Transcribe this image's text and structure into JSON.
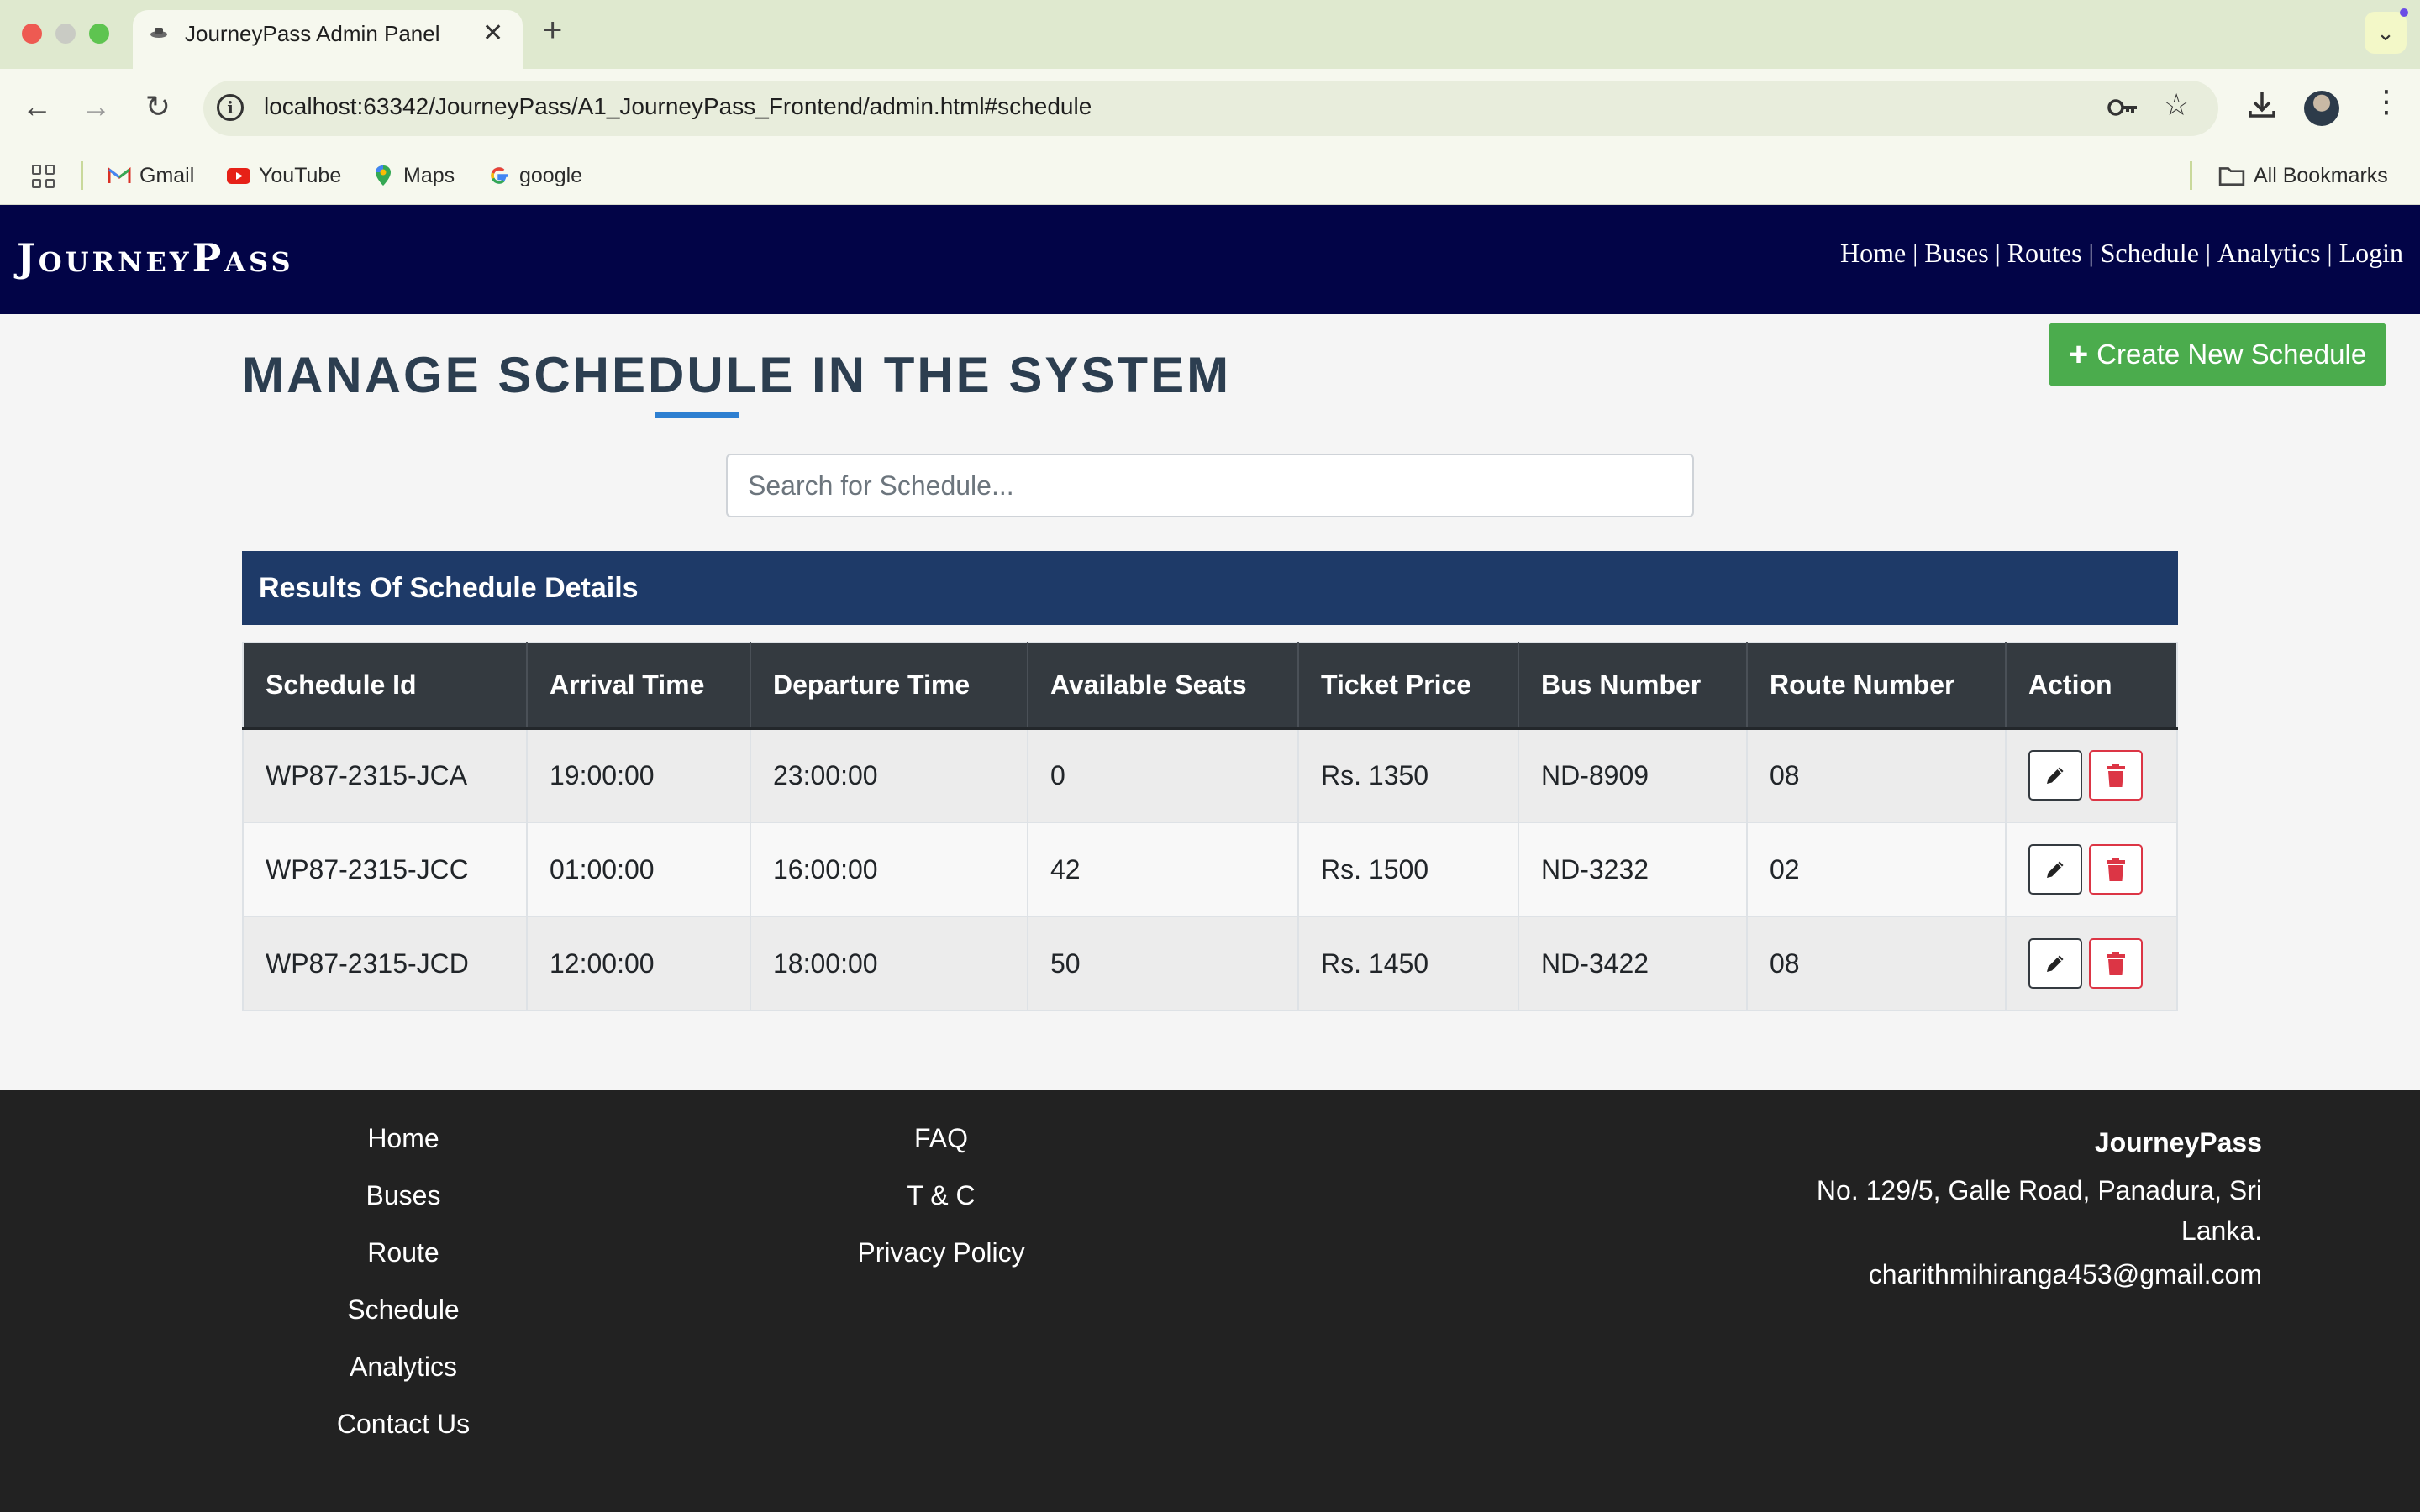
{
  "browser": {
    "tab_title": "JourneyPass Admin Panel",
    "url_prefix": "localhost",
    "url": "localhost:63342/JourneyPass/A1_JourneyPass_Frontend/admin.html#schedule",
    "bookmarks": [
      {
        "label": "Gmail",
        "icon": "gmail-icon"
      },
      {
        "label": "YouTube",
        "icon": "youtube-icon"
      },
      {
        "label": "Maps",
        "icon": "maps-icon"
      },
      {
        "label": "google",
        "icon": "google-icon"
      }
    ],
    "all_bookmarks": "All Bookmarks"
  },
  "site": {
    "logo": "JourneyPass",
    "nav": [
      "Home",
      "Buses",
      "Routes",
      "Schedule",
      "Analytics",
      "Login"
    ]
  },
  "main": {
    "title": "MANAGE SCHEDULE IN THE SYSTEM",
    "create_button": "Create New Schedule",
    "search_placeholder": "Search for Schedule...",
    "results_heading": "Results Of Schedule Details",
    "table": {
      "headers": [
        "Schedule Id",
        "Arrival Time",
        "Departure Time",
        "Available Seats",
        "Ticket Price",
        "Bus Number",
        "Route Number",
        "Action"
      ],
      "rows": [
        [
          "WP87-2315-JCA",
          "19:00:00",
          "23:00:00",
          "0",
          "Rs. 1350",
          "ND-8909",
          "08"
        ],
        [
          "WP87-2315-JCC",
          "01:00:00",
          "16:00:00",
          "42",
          "Rs. 1500",
          "ND-3232",
          "02"
        ],
        [
          "WP87-2315-JCD",
          "12:00:00",
          "18:00:00",
          "50",
          "Rs. 1450",
          "ND-3422",
          "08"
        ]
      ]
    }
  },
  "footer": {
    "col1": [
      "Home",
      "Buses",
      "Route",
      "Schedule",
      "Analytics",
      "Contact Us"
    ],
    "col2": [
      "FAQ",
      "T & C",
      "Privacy Policy"
    ],
    "contact": {
      "name": "JourneyPass",
      "address": "No. 129/5, Galle Road, Panadura, Sri Lanka.",
      "email": "charithmihiranga453@gmail.com"
    }
  },
  "colors": {
    "header_bg": "#020447",
    "results_bar": "#1e3a68",
    "create_button": "#4bac4d",
    "footer_bg": "#222222",
    "title_text": "#2c3e50"
  }
}
